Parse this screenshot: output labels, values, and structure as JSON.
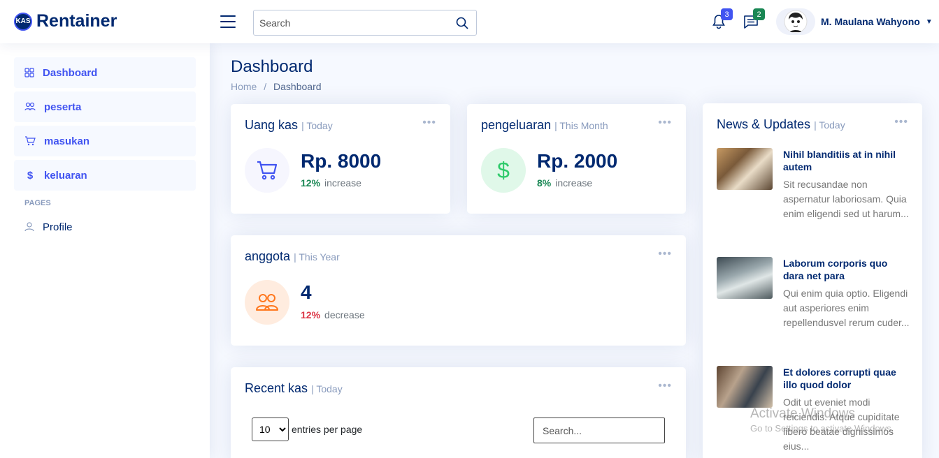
{
  "header": {
    "logo_mark": "KAS",
    "logo_text": "Rentainer",
    "search_placeholder": "Search",
    "notif_count": "3",
    "msg_count": "2",
    "user_name": "M. Maulana Wahyono"
  },
  "sidebar": {
    "items": [
      {
        "label": "Dashboard"
      },
      {
        "label": "peserta"
      },
      {
        "label": "masukan"
      },
      {
        "label": "keluaran"
      }
    ],
    "pages_heading": "PAGES",
    "profile_label": "Profile"
  },
  "page": {
    "title": "Dashboard",
    "crumb_home": "Home",
    "crumb_sep": "/",
    "crumb_current": "Dashboard"
  },
  "cards": {
    "kas": {
      "title": "Uang kas",
      "period": "| Today",
      "value": "Rp. 8000",
      "pct": "12%",
      "trend": "increase"
    },
    "pengeluaran": {
      "title": "pengeluaran",
      "period": "| This Month",
      "value": "Rp. 2000",
      "pct": "8%",
      "trend": "increase"
    },
    "anggota": {
      "title": "anggota",
      "period": "| This Year",
      "value": "4",
      "pct": "12%",
      "trend": "decrease"
    },
    "recent": {
      "title": "Recent kas",
      "period": "| Today",
      "entries_value": "10",
      "entries_label": "entries per page",
      "search_placeholder": "Search..."
    }
  },
  "news": {
    "title": "News & Updates",
    "period": "| Today",
    "items": [
      {
        "title": "Nihil blanditiis at in nihil autem",
        "text": "Sit recusandae non aspernatur laboriosam. Quia enim eligendi sed ut harum..."
      },
      {
        "title": "Laborum corporis quo dara net para",
        "text": "Qui enim quia optio. Eligendi aut asperiores enim repellendusvel rerum cuder..."
      },
      {
        "title": "Et dolores corrupti quae illo quod dolor",
        "text": "Odit ut eveniet modi reiciendis. Atque cupiditate libero beatae dignissimos eius..."
      }
    ]
  },
  "watermark": {
    "line1": "Activate Windows",
    "line2": "Go to Settings to activate Windows."
  },
  "colors": {
    "primary": "#4154f1",
    "navy": "#012970",
    "success": "#198754",
    "danger": "#dc3545",
    "orange": "#ff771d"
  }
}
